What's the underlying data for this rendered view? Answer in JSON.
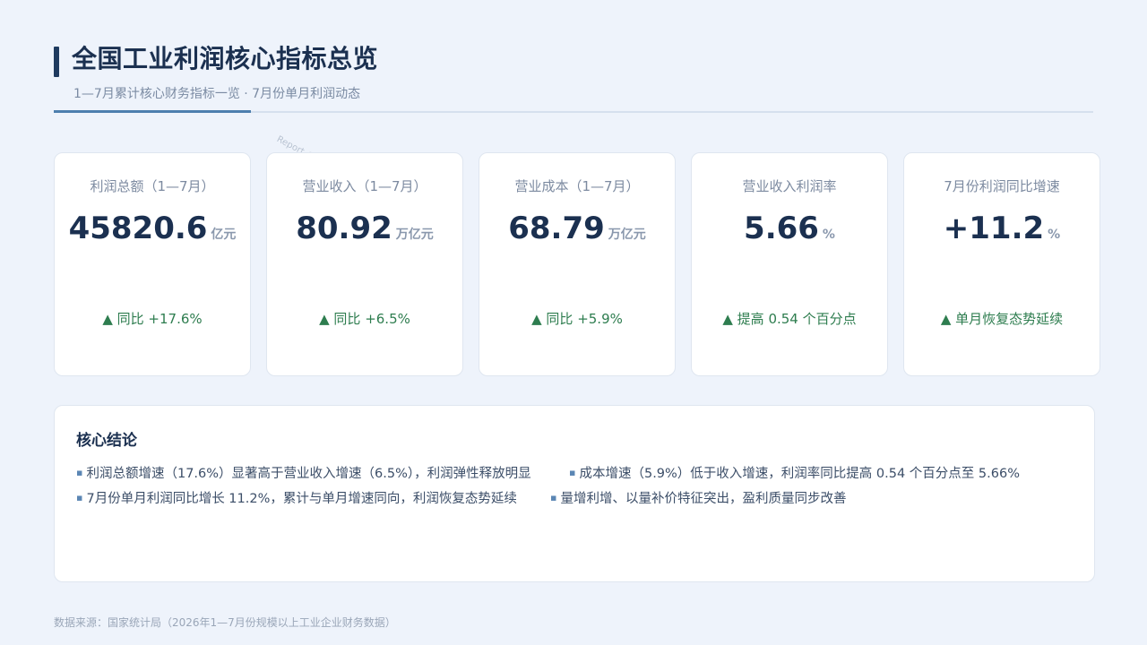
{
  "header": {
    "title": "全国工业利润核心指标总览",
    "subtitle": "1—7月累计核心财务指标一览 · 7月份单月利润动态"
  },
  "watermark": "Report @ AIDataSlide.com",
  "kpis": [
    {
      "label": "利润总额（1—7月）",
      "value": "45820.6",
      "unit": "亿元",
      "change": "▲ 同比 +17.6%"
    },
    {
      "label": "营业收入（1—7月）",
      "value": "80.92",
      "unit": "万亿元",
      "change": "▲ 同比 +6.5%"
    },
    {
      "label": "营业成本（1—7月）",
      "value": "68.79",
      "unit": "万亿元",
      "change": "▲ 同比 +5.9%"
    },
    {
      "label": "营业收入利润率",
      "value": "5.66",
      "unit": "%",
      "change": "▲ 提高 0.54 个百分点"
    },
    {
      "label": "7月份利润同比增速",
      "value": "+11.2",
      "unit": "%",
      "change": "▲ 单月恢复态势延续"
    }
  ],
  "conclusion": {
    "title": "核心结论",
    "points": [
      "利润总额增速（17.6%）显著高于营业收入增速（6.5%），利润弹性释放明显",
      "成本增速（5.9%）低于收入增速，利润率同比提高 0.54 个百分点至 5.66%",
      "7月份单月利润同比增长 11.2%，累计与单月增速同向，利润恢复态势延续",
      "量增利增、以量补价特征突出，盈利质量同步改善"
    ]
  },
  "footer": {
    "source": "数据来源：国家统计局（2026年1—7月份规模以上工业企业财务数据）"
  },
  "colors": {
    "background": "#eef3fb",
    "title": "#1b3050",
    "positive": "#2e7d4f",
    "accent": "#4d7fae"
  }
}
